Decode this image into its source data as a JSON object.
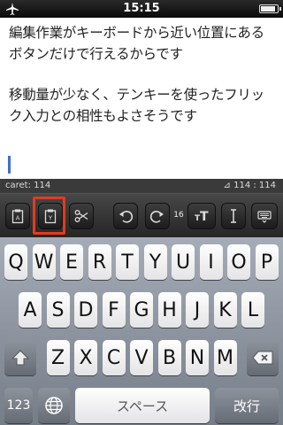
{
  "status_bar": {
    "time": "15:15",
    "airplane_icon": "airplane-icon",
    "battery_level": 0.9
  },
  "editor": {
    "lines": [
      "編集作業がキーボードから近い位置にある",
      "ボタンだけで行えるからです",
      "移動量が少なく、テンキーを使ったフリッ",
      "ク入力との相性もよさそうです"
    ]
  },
  "info_bar": {
    "caret_label": "caret: 114",
    "position_label": "⊿ 114 : 114"
  },
  "toolbar": {
    "buttons": [
      "paste-a-icon",
      "paste-y-icon",
      "scissors-icon",
      "undo-icon",
      "redo-icon",
      "font-size-icon",
      "text-cursor-icon",
      "keyboard-hide-icon"
    ],
    "font_size_value": "16",
    "highlight_color": "#e23b1f"
  },
  "keyboard": {
    "row1": [
      "Q",
      "W",
      "E",
      "R",
      "T",
      "Y",
      "U",
      "I",
      "O",
      "P"
    ],
    "row2": [
      "A",
      "S",
      "D",
      "F",
      "G",
      "H",
      "J",
      "K",
      "L"
    ],
    "row3": [
      "Z",
      "X",
      "C",
      "V",
      "B",
      "N",
      "M"
    ],
    "numbers_label": "123",
    "space_label": "スペース",
    "return_label": "改行"
  }
}
